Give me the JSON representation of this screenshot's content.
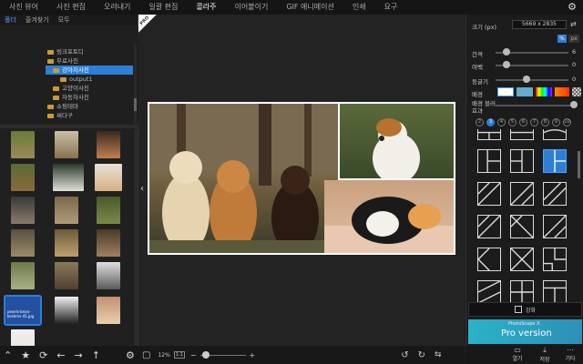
{
  "topbar": {
    "tabs": [
      "사진 뷰어",
      "사진 편집",
      "오려내기",
      "일괄 편집",
      "콜라주",
      "이어붙이기",
      "GIF 애니메이션",
      "인쇄",
      "요구"
    ],
    "active_index": 4
  },
  "left": {
    "subtabs": [
      "폴더",
      "즐겨찾기",
      "모두"
    ],
    "tree": [
      {
        "label": "링크포토디",
        "indent": 1
      },
      {
        "label": "무료사진",
        "indent": 1
      },
      {
        "label": "강아지사진",
        "indent": 2,
        "selected": true
      },
      {
        "label": "output1",
        "indent": 3
      },
      {
        "label": "고양이사진",
        "indent": 2
      },
      {
        "label": "자동차사진",
        "indent": 2
      },
      {
        "label": "쇼핑테마",
        "indent": 1
      },
      {
        "label": "써다구",
        "indent": 1
      }
    ],
    "selected_thumb_caption": "pexels-bean-brahms-45.jpg",
    "bottom_icons": [
      "up-arrow-icon",
      "star-icon",
      "refresh-icon",
      "back-icon",
      "forward-icon",
      "up-icon",
      "gear-icon"
    ]
  },
  "canvas": {
    "pro_label": "PRO",
    "zoom": "12%",
    "zoom_box": "1:1"
  },
  "right": {
    "size_label": "크기 (px)",
    "size_value": "5669 x 2835",
    "unit": "%",
    "px": "px",
    "spacing_label": "간격",
    "spacing_value": "6",
    "margin_label": "여백",
    "margin_value": "0",
    "radius_label": "둥글기",
    "radius_value": "0",
    "bg_label": "배경",
    "bg_blur_label": "배경 블러효과",
    "numbers": [
      "2",
      "3",
      "4",
      "5",
      "6",
      "7",
      "8",
      "9",
      "10"
    ],
    "active_number": "3",
    "apply_button": "강화",
    "pro_banner_title": "PhotoScape X",
    "pro_banner_text": "Pro version",
    "bottom_buttons": [
      "열기",
      "저장",
      "기타"
    ]
  }
}
